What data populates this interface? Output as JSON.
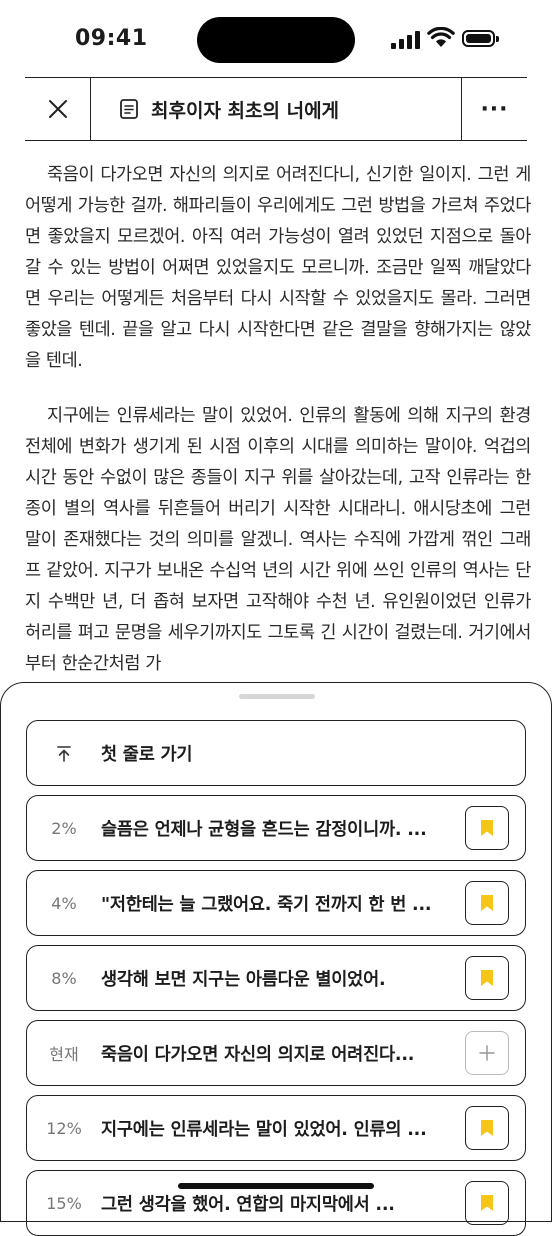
{
  "status": {
    "time": "09:41"
  },
  "header": {
    "title": "최후이자 최초의 너에게",
    "more_label": "···"
  },
  "content": {
    "paragraphs": [
      "죽음이 다가오면 자신의 의지로 어려진다니, 신기한 일이지. 그런 게 어떻게 가능한 걸까. 해파리들이 우리에게도 그런 방법을 가르쳐 주었다면 좋았을지 모르겠어. 아직 여러 가능성이 열려 있었던 지점으로 돌아갈 수 있는 방법이 어쩌면 있었을지도 모르니까. 조금만 일찍 깨달았다면 우리는 어떻게든 처음부터 다시 시작할 수 있었을지도 몰라. 그러면 좋았을 텐데. 끝을 알고 다시 시작한다면 같은 결말을 향해가지는 않았을 텐데.",
      "지구에는 인류세라는 말이 있었어. 인류의 활동에 의해 지구의 환경 전체에 변화가 생기게 된 시점 이후의 시대를 의미하는 말이야. 억겁의 시간 동안 수없이 많은 종들이 지구 위를 살아갔는데, 고작 인류라는 한 종이 별의 역사를 뒤흔들어 버리기 시작한 시대라니. 애시당초에 그런 말이 존재했다는 것의 의미를 알겠니. 역사는 수직에 가깝게 꺾인 그래프 같았어. 지구가 보내온 수십억 년의 시간 위에 쓰인 인류의 역사는 단지 수백만 년, 더 좁혀 보자면 고작해야 수천 년. 유인원이었던 인류가 허리를 펴고 문명을 세우기까지도 그토록 긴 시간이 걸렸는데. 거기에서부터 한순간처럼 가"
    ]
  },
  "sheet": {
    "first_line_label": "첫 줄로 가기",
    "bookmarks": [
      {
        "pct": "2%",
        "text": "슬픔은 언제나 균형을 흔드는 감정이니까. ...",
        "marked": true
      },
      {
        "pct": "4%",
        "text": "\"저한테는 늘 그랬어요. 죽기 전까지 한 번 ...",
        "marked": true
      },
      {
        "pct": "8%",
        "text": "생각해 보면 지구는 아름다운 별이었어.",
        "marked": true
      },
      {
        "pct": "현재",
        "text": "죽음이 다가오면 자신의 의지로 어려진다...",
        "marked": false
      },
      {
        "pct": "12%",
        "text": "지구에는 인류세라는 말이 있었어. 인류의 ...",
        "marked": true
      },
      {
        "pct": "15%",
        "text": "그런 생각을 했어. 연합의 마지막에서 ...",
        "marked": true
      }
    ]
  },
  "colors": {
    "bookmark": "#F5C518",
    "text": "#1c1c1c",
    "muted": "#777777"
  }
}
